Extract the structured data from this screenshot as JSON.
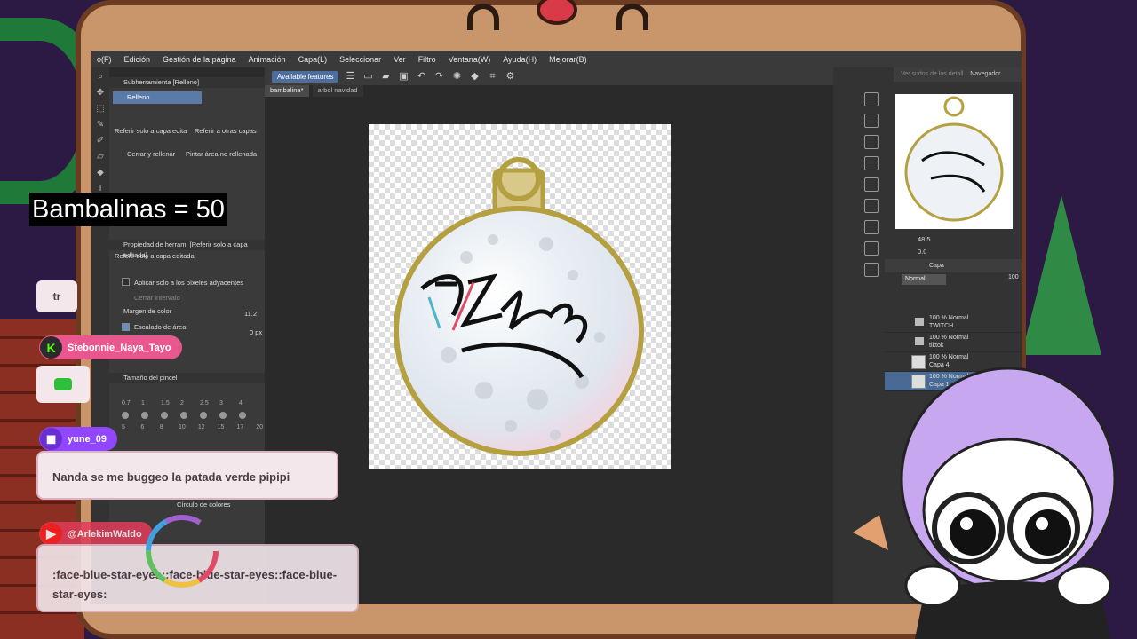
{
  "menu": [
    "o(F)",
    "Edición",
    "Gestión de la página",
    "Animación",
    "Capa(L)",
    "Seleccionar",
    "Ver",
    "Filtro",
    "Ventana(W)",
    "Ayuda(H)",
    "Mejorar(B)"
  ],
  "toolbar": {
    "available_features": "Available features"
  },
  "doc_tabs": [
    "bambalina*",
    "arbol navidad"
  ],
  "subtool": {
    "header": "Subherramienta [Relleno]",
    "active_group": "Relleno",
    "items": [
      "Referir solo a capa edita",
      "Referir a otras capas",
      "Cerrar y rellenar",
      "Pintar área no rellenada"
    ]
  },
  "tool_property": {
    "header": "Propiedad de herram. [Referir solo a capa editada]",
    "preset": "Referir solo a capa editada",
    "adjacent": "Aplicar solo a los píxeles adyacentes",
    "close_gap": "Cerrar intervalo",
    "color_margin_label": "Margen de color",
    "color_margin_value": "11.2",
    "area_scaling_label": "Escalado de área",
    "area_scaling_value": "0 px"
  },
  "brush_size": {
    "header": "Tamaño del pincel",
    "row1": [
      "0.7",
      "1",
      "1.5",
      "2",
      "2.5",
      "3",
      "4"
    ],
    "row2": [
      "5",
      "6",
      "8",
      "10",
      "12",
      "15",
      "17",
      "20"
    ]
  },
  "color_circle": {
    "header": "Círculo de colores"
  },
  "navigator": {
    "tab_inactive": "Ver sudos de los detall",
    "tab_active": "Navegador",
    "zoom": "48.5",
    "angle": "0.0"
  },
  "layers": {
    "tab": "Capa",
    "blend": "Normal",
    "opacity": "100",
    "items": [
      {
        "blend": "100 % Normal",
        "name": "TWITCH",
        "type": "folder"
      },
      {
        "blend": "100 % Normal",
        "name": "tiktok",
        "type": "folder"
      },
      {
        "blend": "100 % Normal",
        "name": "Capa 4",
        "type": "layer"
      },
      {
        "blend": "100 % Normal",
        "name": "Capa 1",
        "type": "layer",
        "active": true
      }
    ]
  },
  "overlay": {
    "counter": "Bambalinas = 50",
    "chat": [
      {
        "user": "",
        "text": "tr"
      },
      {
        "user": "Stebonnie_Naya_Tayo",
        "text": "",
        "platform": "kick",
        "color": "#e8588e"
      },
      {
        "user": "yune_09",
        "text": "Nanda se me buggeo la patada verde pipipi",
        "platform": "twitch",
        "color": "#9147ff"
      },
      {
        "user": "@ArlekimWaldo",
        "text": ":face-blue-star-eyes::face-blue-star-eyes::face-blue-star-eyes:",
        "platform": "youtube",
        "color": "#e23b5a"
      }
    ]
  },
  "colors": {
    "accent": "#4a6a96",
    "frame": "#c9956a",
    "ornament_gold": "#b4a040"
  }
}
